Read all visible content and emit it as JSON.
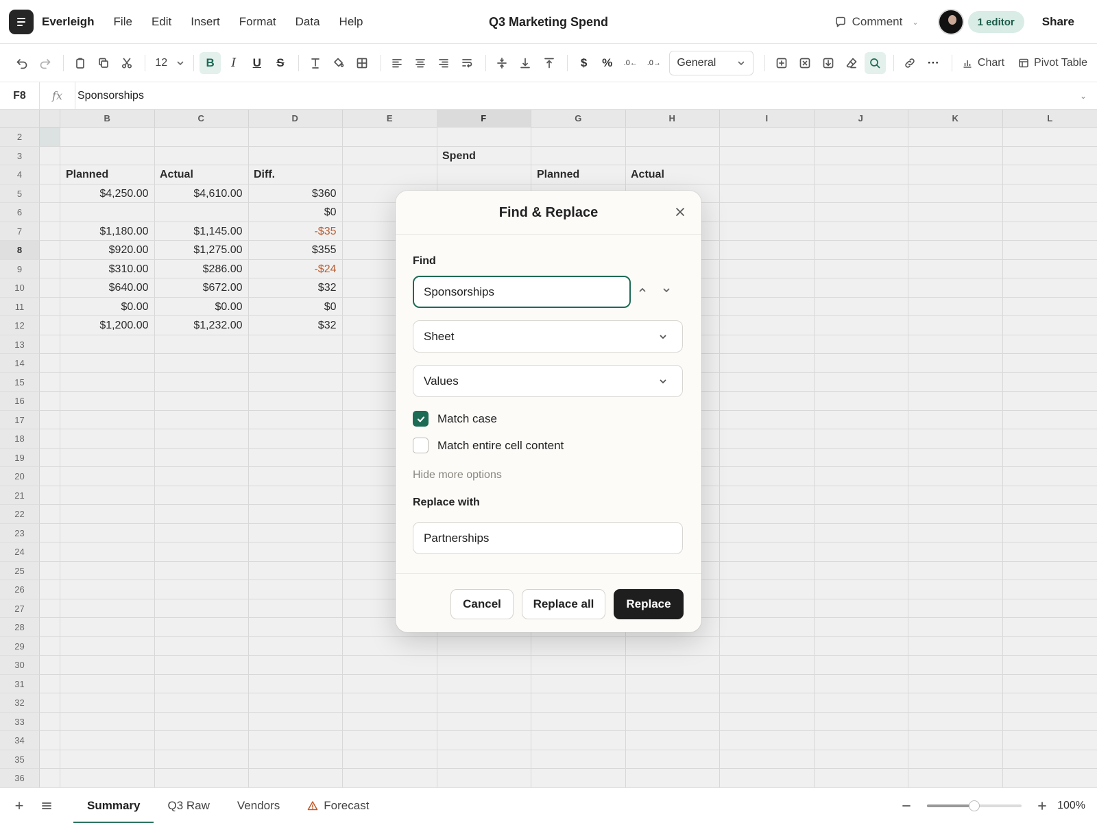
{
  "app": {
    "name": "Everleigh",
    "menus": [
      "File",
      "Edit",
      "Insert",
      "Format",
      "Data",
      "Help"
    ],
    "doc_title": "Q3 Marketing Spend",
    "comment_label": "Comment",
    "editors_label": "1 editor",
    "share_label": "Share"
  },
  "toolbar": {
    "font_size": "12",
    "bold": "B",
    "italic": "I",
    "underline": "U",
    "strike": "S",
    "currency": "$",
    "percent": "%",
    "dec_decrease": ".0←",
    "dec_increase": ".0→",
    "number_format": "General",
    "more": "···",
    "chart_label": "Chart",
    "pivot_label": "Pivot Table"
  },
  "formula_bar": {
    "cell_ref": "F8",
    "fx": "fx",
    "value": "Sponsorships"
  },
  "sheet": {
    "columns": [
      "B",
      "C",
      "D",
      "E",
      "F",
      "G",
      "H",
      "I",
      "J",
      "K",
      "L"
    ],
    "selected_column": "F",
    "selected_row": "8",
    "rows": [
      {
        "n": "2",
        "cells": [
          "",
          "",
          "",
          "",
          "",
          "",
          ""
        ]
      },
      {
        "n": "3",
        "cells": [
          "",
          "",
          "",
          "",
          "Spend",
          "",
          ""
        ]
      },
      {
        "n": "4",
        "cells": [
          "Planned",
          "Actual",
          "Diff.",
          "",
          "",
          "Planned",
          "Actual"
        ]
      },
      {
        "n": "5",
        "cells": [
          "$4,250.00",
          "$4,610.00",
          "$360",
          "",
          "",
          "",
          ""
        ]
      },
      {
        "n": "6",
        "cells": [
          "",
          "",
          "$0",
          "",
          "",
          "",
          ""
        ]
      },
      {
        "n": "7",
        "cells": [
          "$1,180.00",
          "$1,145.00",
          "-$35",
          "",
          "",
          "",
          ""
        ]
      },
      {
        "n": "8",
        "cells": [
          "$920.00",
          "$1,275.00",
          "$355",
          "",
          "",
          "",
          ""
        ]
      },
      {
        "n": "9",
        "cells": [
          "$310.00",
          "$286.00",
          "-$24",
          "",
          "",
          "",
          ""
        ]
      },
      {
        "n": "10",
        "cells": [
          "$640.00",
          "$672.00",
          "$32",
          "",
          "",
          "",
          ""
        ]
      },
      {
        "n": "11",
        "cells": [
          "$0.00",
          "$0.00",
          "$0",
          "",
          "",
          "",
          ""
        ]
      },
      {
        "n": "12",
        "cells": [
          "$1,200.00",
          "$1,232.00",
          "$32",
          "",
          "",
          "",
          ""
        ]
      }
    ],
    "row_count_last": 36
  },
  "dialog": {
    "title": "Find & Replace",
    "find_label": "Find",
    "find_value": "Sponsorships",
    "scope": "Sheet",
    "search_in": "Values",
    "match_case_label": "Match case",
    "match_case": true,
    "match_entire_label": "Match entire cell content",
    "match_entire": false,
    "hide_options_label": "Hide more options",
    "replace_label": "Replace with",
    "replace_value": "Partnerships",
    "cancel_label": "Cancel",
    "replace_all_label": "Replace all",
    "replace_label_btn": "Replace"
  },
  "tabs": {
    "items": [
      "Summary",
      "Q3 Raw",
      "Vendors",
      "Forecast"
    ],
    "active": "Summary",
    "warning_tab": "Forecast",
    "zoom_level": 0.5,
    "zoom_label": "100%"
  },
  "colors": {
    "accent": "#1c6b55",
    "negative": "#c05a2a"
  }
}
